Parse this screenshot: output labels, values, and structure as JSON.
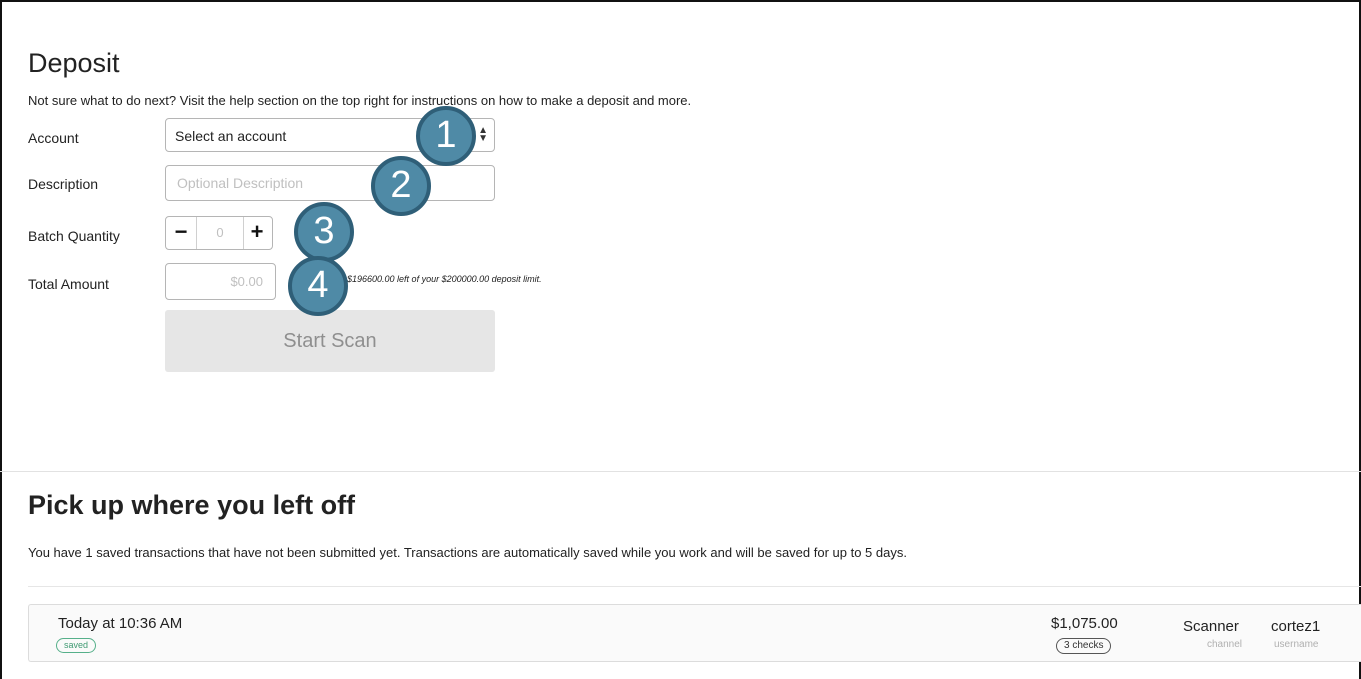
{
  "deposit": {
    "title": "Deposit",
    "help_text": "Not sure what to do next? Visit the help section on the top right for instructions on how to make a deposit and more.",
    "account": {
      "label": "Account",
      "selected": "Select an account"
    },
    "description": {
      "label": "Description",
      "placeholder": "Optional Description",
      "value": ""
    },
    "batch_quantity": {
      "label": "Batch Quantity",
      "value": "0",
      "minus": "−",
      "plus": "+"
    },
    "total_amount": {
      "label": "Total Amount",
      "value": "$0.00",
      "limit_note": "ve $196600.00 left of your $200000.00 deposit limit."
    },
    "start_scan_label": "Start Scan"
  },
  "callouts": [
    "1",
    "2",
    "3",
    "4"
  ],
  "pickup": {
    "title": "Pick up where you left off",
    "description": "You have 1 saved transactions that have not been submitted yet. Transactions are automatically saved while you work and will be saved for up to 5 days.",
    "transactions": [
      {
        "time": "Today at 10:36 AM",
        "status": "saved",
        "amount": "$1,075.00",
        "checks": "3 checks",
        "channel": "Scanner",
        "channel_label": "channel",
        "username": "cortez1",
        "username_label": "username"
      }
    ]
  },
  "colors": {
    "callout_fill": "#4f8aa6",
    "callout_border": "#2f5f78",
    "saved_badge": "#3f9a72",
    "disabled_button": "#e6e6e6"
  }
}
